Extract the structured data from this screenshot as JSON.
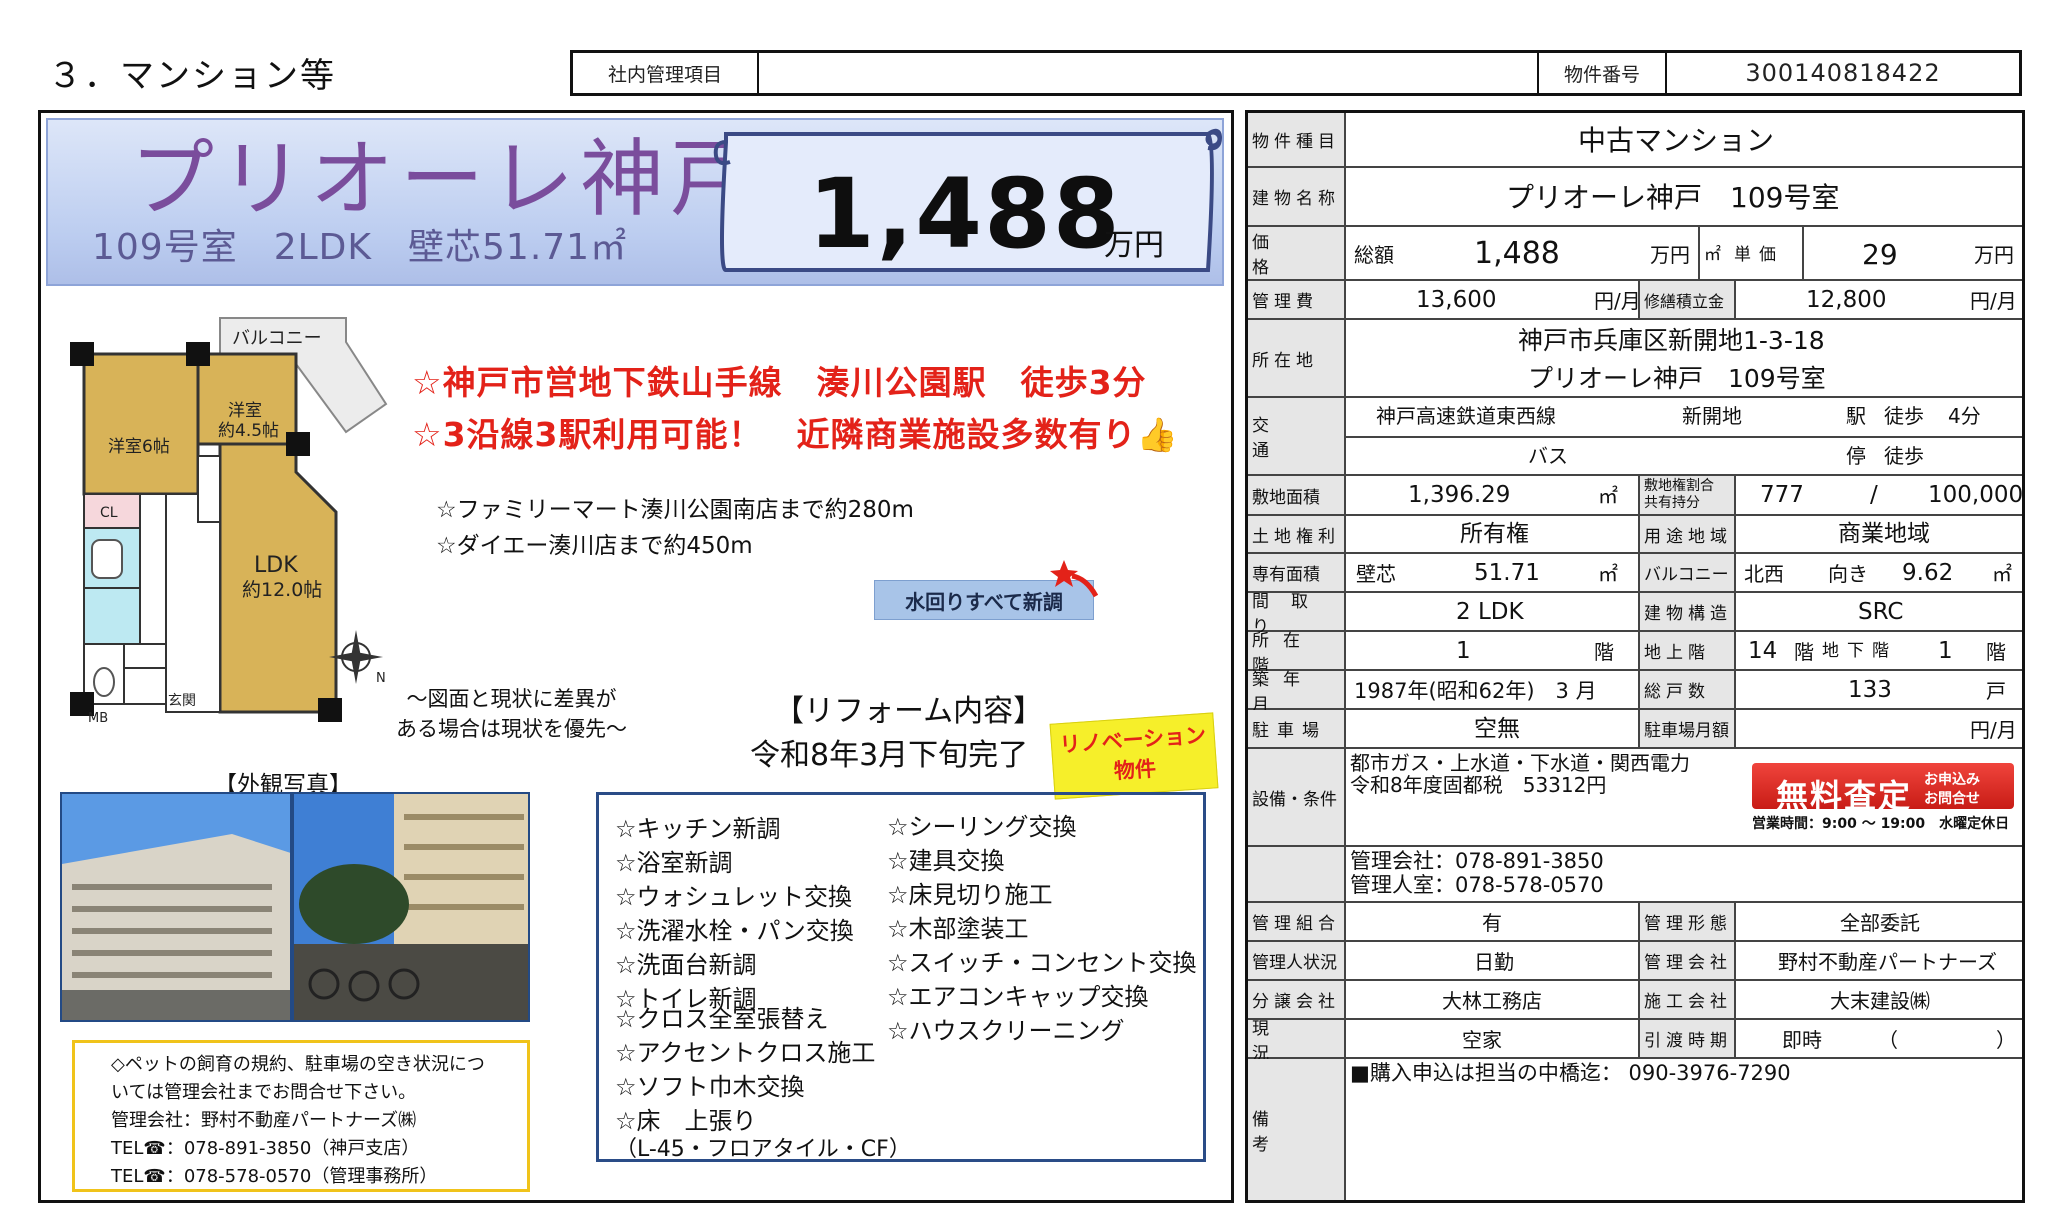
{
  "header": {
    "section_title": "３．マンション等",
    "mgmt_label": "社内管理項目",
    "mgmt_value": "",
    "property_no_label": "物件番号",
    "property_no_value": "300140818422"
  },
  "flyer": {
    "name": "プリオーレ神戸",
    "room": "109号室",
    "layout": "2LDK",
    "area": "壁芯51.71㎡",
    "price": "1,488",
    "price_unit": "万円",
    "headline_1": "☆神戸市営地下鉄山手線　湊川公園駅　徒歩3分",
    "headline_2": "☆3沿線3駅利用可能！　近隣商業施設多数有り👍",
    "nearby_1": "☆ファミリーマート湊川公園南店まで約280m",
    "nearby_2": "☆ダイエー湊川店まで約450m",
    "water_badge": "水回りすべて新調",
    "diff_note_1": "～図面と現状に差異が",
    "diff_note_2": "ある場合は現状を優先～",
    "reform_title": "【リフォーム内容】",
    "reform_date": "令和8年3月下旬完了",
    "reno_badge_1": "リノベーション",
    "reno_badge_2": "物件",
    "photos_title": "【外観写真】",
    "floorplan": {
      "balcony": "バルコニー",
      "western_6": "洋室6帖",
      "western_45_a": "洋室",
      "western_45_b": "約4.5帖",
      "ldk_a": "LDK",
      "ldk_b": "約12.0帖",
      "cl": "CL",
      "entrance": "玄関",
      "mb": "MB",
      "north": "N"
    },
    "pet_note": [
      "◇ペットの飼育の規約、駐車場の空き状況につ",
      "いては管理会社までお問合せ下さい。",
      "管理会社：野村不動産パートナーズ㈱",
      "TEL☎：078-891-3850（神戸支店）",
      "TEL☎：078-578-0570（管理事務所）"
    ],
    "reform_left": [
      "☆キッチン新調",
      "☆浴室新調",
      "☆ウォシュレット交換",
      "☆洗濯水栓・パン交換",
      "☆洗面台新調",
      "☆トイレ新調",
      "☆クロス全室張替え",
      "☆アクセントクロス施工",
      "☆ソフト巾木交換",
      "☆床　上張り",
      "（L-45・フロアタイル・CF）"
    ],
    "reform_right": [
      "☆シーリング交換",
      "☆建具交換",
      "☆床見切り施工",
      "☆木部塗装工",
      "☆スイッチ・コンセント交換",
      "☆エアコンキャップ交換",
      "☆ハウスクリーニング"
    ]
  },
  "info": {
    "type_label": "物件種目",
    "type_value": "中古マンション",
    "bldg_label": "建物名称",
    "bldg_value": "プリオーレ神戸　109号室",
    "price_label": "価格",
    "total_label": "総額",
    "total_value": "1,488",
    "total_unit": "万円",
    "sqm_label": "㎡",
    "unit_price_label": "単価",
    "unit_price_value": "29",
    "unit_price_unit": "万円",
    "mgmt_fee_label": "管理費",
    "mgmt_fee_value": "13,600",
    "mgmt_fee_unit": "円/月",
    "repair_label": "修繕積立金",
    "repair_value": "12,800",
    "repair_unit": "円/月",
    "address_label": "所在地",
    "address_1": "神戸市兵庫区新開地1-3-18",
    "address_2": "プリオーレ神戸　109号室",
    "traffic_label": "交通",
    "line_1": "神戸高速鉄道東西線",
    "station_1": "新開地",
    "walk_1_a": "駅",
    "walk_1_b": "徒歩",
    "walk_1_c": "4分",
    "line_2": "バス",
    "walk_2_a": "停",
    "walk_2_b": "徒歩",
    "land_area_label": "敷地面積",
    "land_area_value": "1,396.29",
    "land_area_unit": "㎡",
    "share_label_1": "敷地権割合",
    "share_label_2": "共有持分",
    "share_value_1": "777",
    "share_slash": "/",
    "share_value_2": "100,000",
    "land_right_label": "土地権利",
    "land_right_value": "所有権",
    "zoning_label": "用途地域",
    "zoning_value": "商業地域",
    "private_area_label": "専有面積",
    "private_area_kind": "壁芯",
    "private_area_value": "51.71",
    "private_area_unit": "㎡",
    "balcony_label": "バルコニー",
    "balcony_dir": "北西",
    "balcony_dir_suffix": "向き",
    "balcony_value": "9.62",
    "balcony_unit": "㎡",
    "layout_label": "間取り",
    "layout_value": "2 LDK",
    "structure_label": "建物構造",
    "structure_value": "SRC",
    "floor_label": "所在階",
    "floor_value": "1",
    "floor_unit": "階",
    "above_label": "地上階",
    "above_value": "14",
    "above_unit": "階",
    "below_label": "地下階",
    "below_value": "1",
    "below_unit": "階",
    "built_label": "築年月",
    "built_value": "1987年(昭和62年)　3 月",
    "units_label": "総戸数",
    "units_value": "133",
    "units_unit": "戸",
    "parking_label": "駐車場",
    "parking_value": "空無",
    "parking_fee_label": "駐車場月額",
    "parking_fee_unit": "円/月",
    "facility_label": "設備・条件",
    "facility_1": "都市ガス・上水道・下水道・関西電力",
    "facility_2": "令和8年度固都税　53312円",
    "assess_main": "無料査定",
    "assess_side_1": "お申込み",
    "assess_side_2": "お問合せ",
    "assess_hours": "営業時間：9:00 ～ 19:00　水曜定休日",
    "company_tel": "管理会社：078-891-3850",
    "office_tel": "管理人室：078-578-0570",
    "assoc_label": "管理組合",
    "assoc_value": "有",
    "mgmt_form_label": "管理形態",
    "mgmt_form_value": "全部委託",
    "manager_label": "管理人状況",
    "manager_value": "日勤",
    "mgmt_co_label": "管理会社",
    "mgmt_co_value": "野村不動産パートナーズ",
    "seller_label": "分譲会社",
    "seller_value": "大林工務店",
    "builder_label": "施工会社",
    "builder_value": "大末建設㈱",
    "status_label": "現況",
    "status_value": "空家",
    "handover_label": "引渡時期",
    "handover_value": "即時",
    "handover_paren_open": "（",
    "handover_paren_close": "）",
    "remarks_label": "備考",
    "remarks_value": "■購入申込は担当の中橋迄：  090-3976-7290"
  }
}
